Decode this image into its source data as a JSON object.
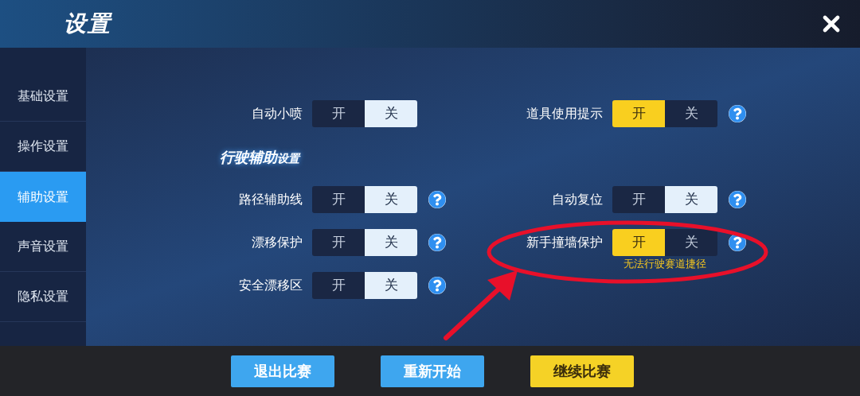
{
  "header": {
    "title": "设置"
  },
  "sidebar": {
    "items": [
      {
        "label": "基础设置",
        "selected": false
      },
      {
        "label": "操作设置",
        "selected": false
      },
      {
        "label": "辅助设置",
        "selected": true
      },
      {
        "label": "声音设置",
        "selected": false
      },
      {
        "label": "隐私设置",
        "selected": false
      }
    ]
  },
  "left_column": [
    {
      "kind": "setting",
      "label": "自动小喷",
      "on_label": "开",
      "off_label": "关",
      "on": false,
      "help": false
    },
    {
      "kind": "heading",
      "label": "行驶辅助",
      "suffix": "设置"
    },
    {
      "kind": "setting",
      "label": "路径辅助线",
      "on_label": "开",
      "off_label": "关",
      "on": false,
      "help": true
    },
    {
      "kind": "setting",
      "label": "漂移保护",
      "on_label": "开",
      "off_label": "关",
      "on": false,
      "help": true
    },
    {
      "kind": "setting",
      "label": "安全漂移区",
      "on_label": "开",
      "off_label": "关",
      "on": false,
      "help": true
    }
  ],
  "right_column": [
    {
      "kind": "setting",
      "label": "道具使用提示",
      "on_label": "开",
      "off_label": "关",
      "on": true,
      "help": true
    },
    {
      "kind": "spacer"
    },
    {
      "kind": "setting",
      "label": "自动复位",
      "on_label": "开",
      "off_label": "关",
      "on": false,
      "help": true
    },
    {
      "kind": "setting",
      "label": "新手撞墙保护",
      "on_label": "开",
      "off_label": "关",
      "on": true,
      "help": true,
      "note": "无法行驶赛道捷径"
    }
  ],
  "buttons": [
    {
      "label": "退出比赛",
      "kind": "primary"
    },
    {
      "label": "重新开始",
      "kind": "primary"
    },
    {
      "label": "继续比赛",
      "kind": "accent"
    }
  ],
  "annotation": {
    "kind": "circle-arrow"
  }
}
